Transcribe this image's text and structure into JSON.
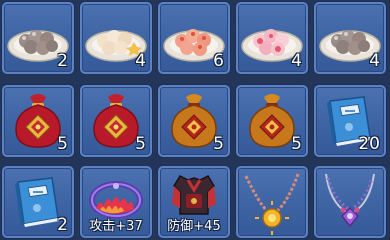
{
  "inventory": {
    "slots": [
      {
        "item": "grey-tangyuan-plate-icon",
        "qty": "2"
      },
      {
        "item": "flower-tangyuan-plate-icon",
        "qty": "4"
      },
      {
        "item": "peach-tangyuan-plate-icon",
        "qty": "6"
      },
      {
        "item": "rose-tangyuan-plate-icon",
        "qty": "4"
      },
      {
        "item": "grey-tangyuan-plate-icon",
        "qty": "4"
      },
      {
        "item": "red-lucky-bag-icon",
        "qty": "5"
      },
      {
        "item": "red-lucky-bag-icon",
        "qty": "5"
      },
      {
        "item": "gold-lucky-bag-icon",
        "qty": "5"
      },
      {
        "item": "gold-lucky-bag-icon",
        "qty": "5"
      },
      {
        "item": "blue-skill-book-icon",
        "qty": "20"
      },
      {
        "item": "blue-skill-book-icon",
        "qty": "2"
      },
      {
        "item": "flame-crown-icon",
        "stat": "攻击+37"
      },
      {
        "item": "red-armor-icon",
        "stat": "防御+45"
      },
      {
        "item": "sun-necklace-icon"
      },
      {
        "item": "purple-necklace-icon"
      }
    ]
  },
  "colors": {
    "slot_bg": "#4b71b1",
    "slot_border": "#5b83c4",
    "qty_text": "#ffffff"
  }
}
